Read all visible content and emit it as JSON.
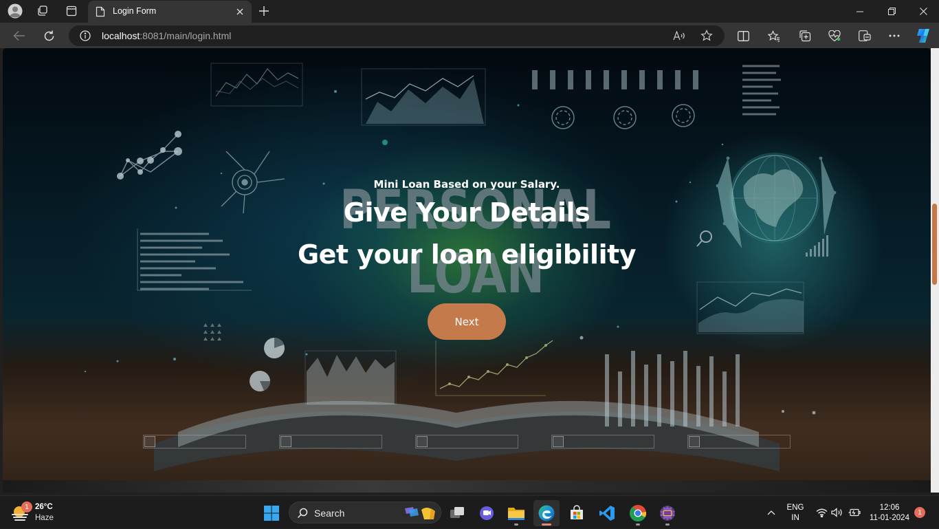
{
  "browser": {
    "tab_title": "Login Form",
    "url_host": "localhost",
    "url_rest": ":8081/main/login.html"
  },
  "hero": {
    "background_words": [
      "PERSONAL",
      "LOAN"
    ],
    "subtitle": "Mini Loan Based on your Salary.",
    "heading_line1": "Give Your Details",
    "heading_line2": "Get your loan eligibility",
    "next_button": "Next",
    "broken_image_count": 5
  },
  "taskbar": {
    "weather_temp": "26°C",
    "weather_condition": "Haze",
    "weather_badge": "1",
    "search_label": "Search",
    "language_line1": "ENG",
    "language_line2": "IN",
    "time": "12:06",
    "date": "11-01-2024",
    "notification_count": "1"
  },
  "colors": {
    "accent_button": "#c47a4b",
    "scroll_thumb": "#c57845",
    "chrome_dark": "#202020",
    "chrome_mid": "#353535"
  }
}
